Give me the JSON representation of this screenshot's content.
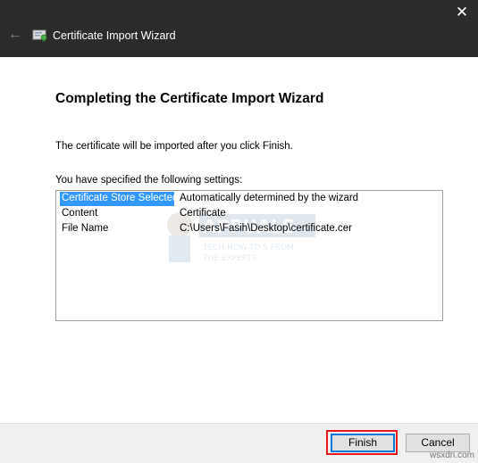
{
  "window": {
    "title": "Certificate Import Wizard",
    "back_symbol": "←",
    "close_symbol": "✕"
  },
  "content": {
    "heading": "Completing the Certificate Import Wizard",
    "info_text": "The certificate will be imported after you click Finish.",
    "settings_label": "You have specified the following settings:",
    "settings": [
      {
        "key": "Certificate Store Selected",
        "value": "Automatically determined by the wizard",
        "selected": true
      },
      {
        "key": "Content",
        "value": "Certificate"
      },
      {
        "key": "File Name",
        "value": "C:\\Users\\Fasih\\Desktop\\certificate.cer"
      }
    ],
    "watermark_lines": [
      "APPUALS",
      "TECH HOW-TO'S FROM",
      "THE EXPERTS"
    ]
  },
  "footer": {
    "finish_label": "Finish",
    "cancel_label": "Cancel",
    "site_mark": "wsxdn.com"
  },
  "colors": {
    "titlebar": "#2b2b2b",
    "selection": "#3399ff",
    "highlight": "#e8171c",
    "default_button_border": "#0078d7"
  }
}
